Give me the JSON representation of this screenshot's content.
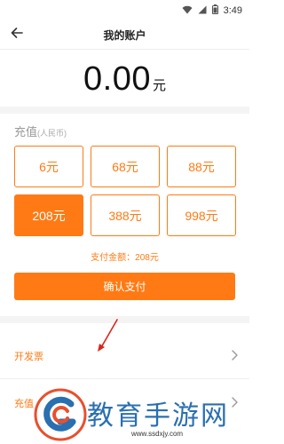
{
  "status_bar": {
    "time": "3:49",
    "icons": [
      "wifi-icon",
      "signal-icon",
      "battery-icon"
    ]
  },
  "header": {
    "back_icon": "arrow-left-icon",
    "title": "我的账户"
  },
  "balance": {
    "amount": "0.00",
    "unit": "元"
  },
  "recharge": {
    "title": "充值",
    "subtitle": "(人民币)",
    "options": [
      {
        "label": "6元",
        "selected": false
      },
      {
        "label": "68元",
        "selected": false
      },
      {
        "label": "88元",
        "selected": false
      },
      {
        "label": "208元",
        "selected": true
      },
      {
        "label": "388元",
        "selected": false
      },
      {
        "label": "998元",
        "selected": false
      }
    ],
    "total_label": "支付金额：208元",
    "confirm_label": "确认支付"
  },
  "list": {
    "invoice_label": "开发票",
    "second_label": "充值"
  },
  "watermark": {
    "text": "教育手游网",
    "url": "www.ssdxjy.com"
  },
  "colors": {
    "accent": "#ff7a14",
    "watermark_blue": "#2a6fb0",
    "annotation_red": "#d9261c"
  }
}
